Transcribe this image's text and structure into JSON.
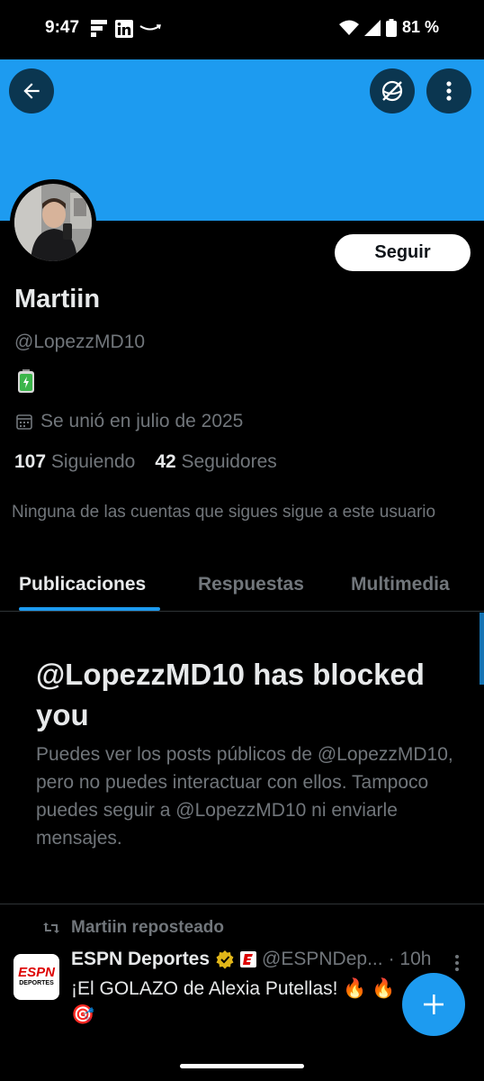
{
  "status_bar": {
    "time": "9:47",
    "battery": "81 %",
    "icons": [
      "flipboard-icon",
      "linkedin-icon",
      "amazon-icon",
      "wifi-icon",
      "signal-icon",
      "battery-icon"
    ]
  },
  "header": {
    "back_icon": "arrow-left-icon",
    "globe_icon": "globe-off-icon",
    "more_icon": "more-vertical-icon",
    "banner_color": "#1d9bf0"
  },
  "profile": {
    "name": "Martiin",
    "handle": "@LopezzMD10",
    "bio_icon": "battery-emoji",
    "joined": "Se unió en julio de 2025",
    "following_count": "107",
    "following_label": "Siguiendo",
    "followers_count": "42",
    "followers_label": "Seguidores",
    "mutual_text": "Ninguna de las cuentas que sigues sigue a este usuario",
    "follow_button": "Seguir"
  },
  "tabs": [
    {
      "label": "Publicaciones",
      "active": true
    },
    {
      "label": "Respuestas",
      "active": false
    },
    {
      "label": "Multimedia",
      "active": false
    }
  ],
  "blocked": {
    "title": "@LopezzMD10 has blocked you",
    "description": "Puedes ver los posts públicos de @LopezzMD10, pero no puedes interactuar con ellos. Tampoco puedes seguir a @LopezzMD10 ni enviarle mensajes."
  },
  "post": {
    "repost_label": "Martiin reposteado",
    "author": "ESPN Deportes",
    "handle": "@ESPNDep...",
    "time": "· 10h",
    "text": "¡El GOLAZO de Alexia Putellas! 🔥 🔥 🎯",
    "avatar_text_top": "ESPN",
    "avatar_text_bottom": "DEPORTES"
  },
  "fab_icon": "plus-icon",
  "colors": {
    "accent": "#1d9bf0",
    "background": "#000000",
    "muted": "#71767b"
  }
}
